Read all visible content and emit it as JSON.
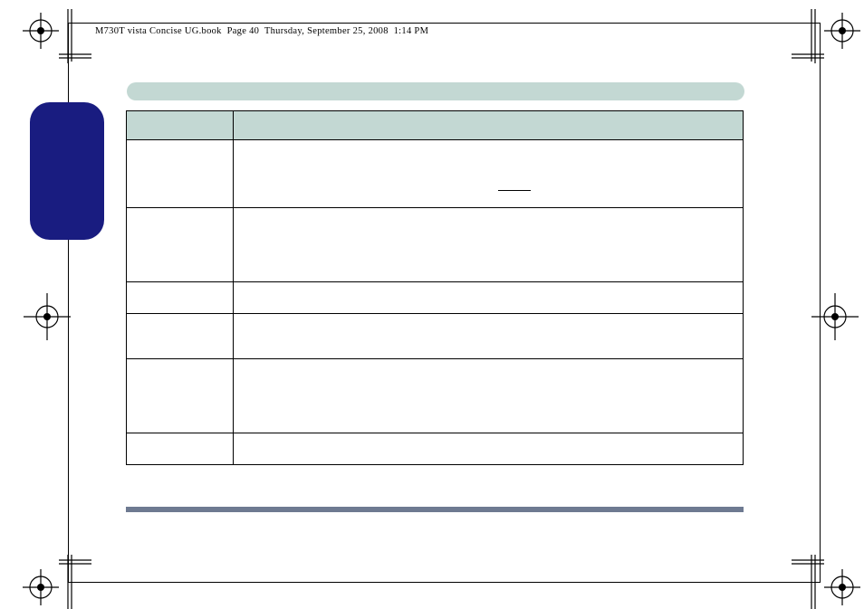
{
  "header_line": "M730T vista Concise UG.book  Page 40  Thursday, September 25, 2008  1:14 PM"
}
